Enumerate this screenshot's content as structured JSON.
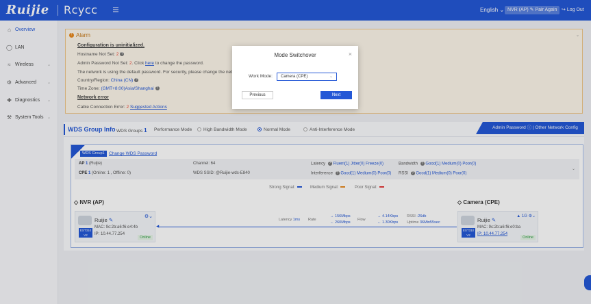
{
  "topbar": {
    "logo": "Ruijie",
    "product": "Rcycc",
    "language": "English",
    "device_pill": "NVR (AP) ✎ Pair Again",
    "logout": "Log Out"
  },
  "sidebar": {
    "items": [
      {
        "label": "Overview",
        "icon": "home-icon",
        "active": true
      },
      {
        "label": "LAN",
        "icon": "globe-icon"
      },
      {
        "label": "Wireless",
        "icon": "wifi-icon"
      },
      {
        "label": "Advanced",
        "icon": "gear-icon"
      },
      {
        "label": "Diagnostics",
        "icon": "diagnostics-icon"
      },
      {
        "label": "System Tools",
        "icon": "tools-icon"
      }
    ]
  },
  "alarm": {
    "title": "Alarm",
    "config_heading": "Configuration is uninitialized.",
    "hostname_label": "Hostname Not Set:",
    "hostname_count": "2",
    "admin_label": "Admin Password Not Set:",
    "admin_count": "2",
    "admin_click": ". Click",
    "admin_here": "here",
    "admin_suffix": "to change the password.",
    "default_pw_note": "The network is using the default password. For security, please change the network password.",
    "country_label": "Country/Region:",
    "country_value": "China (CN)",
    "timezone_label": "Time Zone:",
    "timezone_value": "(GMT+8:00)Asia/Shanghai",
    "network_error": "Network error",
    "cable_label": "Cable Connection Error:",
    "cable_count": "2",
    "suggested": "Suggested Actions"
  },
  "wds": {
    "title": "WDS Group Info",
    "groups_label": "WDS Groups",
    "groups_count": "1",
    "perf_label": "Performance Mode",
    "mode_high": "High Bandwidth Mode",
    "mode_normal": "Normal Mode",
    "mode_anti": "Anti-Interference Mode",
    "admin_banner": "Admin Password ⓘ | Other Network Config",
    "group_tag": "WDS Group1",
    "change_pw": "Change WDS Password",
    "ap_label": "AP",
    "ap_count": "1",
    "ap_detail": "(Ruijie)",
    "cpe_label": "CPE",
    "cpe_count": "1",
    "cpe_detail": "(Online: 1 , Offline: 0)",
    "channel": "Channel: 64",
    "ssid": "WDS SSID: @Ruijie-wds-E840",
    "latency_label": "Latency",
    "latency_vals": "Fluent(1)  Jitter(0)  Freeze(0)",
    "interf_label": "Interference",
    "interf_vals": "Good(1)  Medium(0)  Poor(0)",
    "bw_label": "Bandwidth",
    "bw_vals": "Good(1)  Medium(0)  Poor(0)",
    "rssi_label": "RSSI",
    "rssi_vals": "Good(1)  Medium(0)  Poor(0)",
    "legend_strong": "Strong Signal:",
    "legend_medium": "Medium Signal:",
    "legend_poor": "Poor Signal:",
    "ap_title": "NVR (AP)",
    "cpe_title": "Camera (CPE)",
    "ap_dev": {
      "name": "Ruijie",
      "mac": "MAC: 9c:2b:a6:f6:e4:4b",
      "ip": "IP: 10.44.77.254",
      "badge": "EST310 V2",
      "status": "Online"
    },
    "cpe_dev": {
      "name": "Ruijie",
      "mac": "MAC: 9c:2b:a6:f6:e0:ba",
      "ip": "IP: 10.44.77.254",
      "badge": "EST310 V2",
      "status": "Online"
    },
    "link_latency": "Latency",
    "link_latency_val": "1ms",
    "link_rate": "Rate",
    "rate_up": "156Mbps",
    "rate_down": "260Mbps",
    "link_flow": "Flow",
    "flow_up": "4.14Kbps",
    "flow_down": "1.30Kbps",
    "rssi_txt": "RSSI",
    "rssi_val": "-26db",
    "uptime_txt": "Uptime",
    "uptime_val": "36Min55sec",
    "signal_count": "1G"
  },
  "modal": {
    "title": "Mode Switchover",
    "work_mode_label": "Work Mode:",
    "work_mode_value": "Camera (CPE)",
    "previous": "Previous",
    "next": "Next"
  },
  "colors": {
    "accent": "#2458d6",
    "strong": "#2458d6",
    "medium": "#e8891e",
    "poor": "#e43a3a"
  }
}
